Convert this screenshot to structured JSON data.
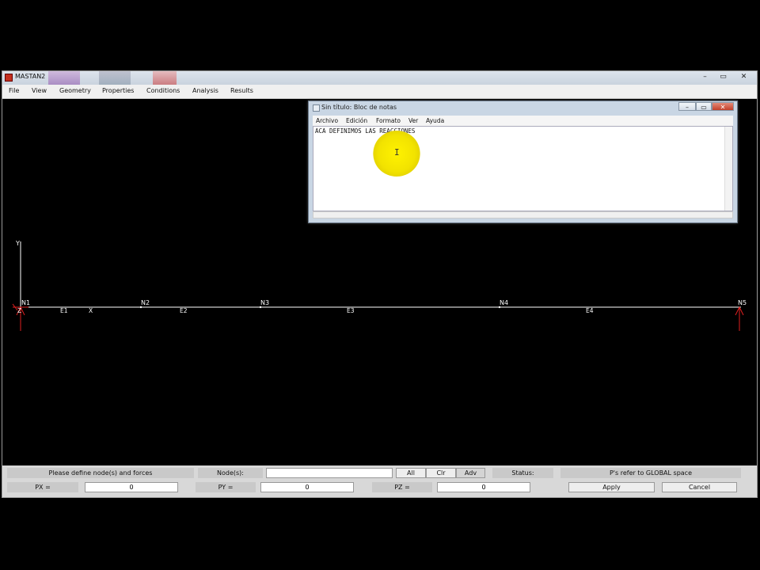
{
  "app": {
    "title": "MASTAN2",
    "menu": [
      "File",
      "View",
      "Geometry",
      "Properties",
      "Conditions",
      "Analysis",
      "Results"
    ],
    "window_controls": [
      "–",
      "▭",
      "✕"
    ]
  },
  "notepad": {
    "title": "Sin título: Bloc de notas",
    "menu": [
      "Archivo",
      "Edición",
      "Formato",
      "Ver",
      "Ayuda"
    ],
    "text": "ACA DEFINIMOS LAS REACCIONES",
    "controls": [
      "–",
      "▭",
      "✕"
    ]
  },
  "model": {
    "axis_y": "Y",
    "axis_x": "X",
    "axis_z": "Z",
    "nodes": [
      "N1",
      "N2",
      "N3",
      "N4",
      "N5"
    ],
    "elements": [
      "E1",
      "E2",
      "E3",
      "E4"
    ],
    "colors": {
      "line": "#ffffff",
      "support": "#e02020",
      "background": "#000000"
    }
  },
  "panel": {
    "prompt": "Please define node(s) and forces",
    "nodes_label": "Node(s):",
    "nodes_value": "",
    "btn_all": "All",
    "btn_clr": "Clr",
    "btn_adv": "Adv",
    "status_label": "Status:",
    "status_value": "P's refer to GLOBAL space",
    "px_label": "PX =",
    "px_value": "0",
    "py_label": "PY =",
    "py_value": "0",
    "pz_label": "PZ =",
    "pz_value": "0",
    "apply": "Apply",
    "cancel": "Cancel"
  }
}
